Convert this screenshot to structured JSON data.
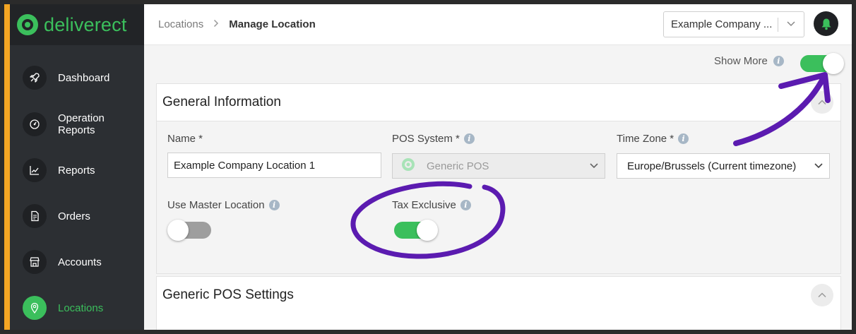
{
  "brand": {
    "name": "deliverect",
    "color": "#3bbf5c",
    "accent": "#f5a623"
  },
  "sidebar": {
    "items": [
      {
        "label": "Dashboard",
        "icon": "rocket-icon",
        "active": false
      },
      {
        "label": "Operation Reports",
        "icon": "gauge-icon",
        "active": false
      },
      {
        "label": "Reports",
        "icon": "chart-icon",
        "active": false
      },
      {
        "label": "Orders",
        "icon": "document-icon",
        "active": false
      },
      {
        "label": "Accounts",
        "icon": "store-icon",
        "active": false
      },
      {
        "label": "Locations",
        "icon": "location-pin-icon",
        "active": true
      }
    ]
  },
  "header": {
    "breadcrumb": {
      "parent": "Locations",
      "current": "Manage Location"
    },
    "company_select": {
      "value": "Example Company ..."
    }
  },
  "show_more": {
    "label": "Show More",
    "enabled": true
  },
  "general_info": {
    "title": "General Information",
    "name": {
      "label": "Name *",
      "value": "Example Company Location 1"
    },
    "pos_system": {
      "label": "POS System *",
      "value": "Generic POS",
      "disabled": true
    },
    "time_zone": {
      "label": "Time Zone *",
      "value": "Europe/Brussels (Current timezone)"
    },
    "use_master_location": {
      "label": "Use Master Location",
      "enabled": false
    },
    "tax_exclusive": {
      "label": "Tax Exclusive",
      "enabled": true
    }
  },
  "generic_pos_settings": {
    "title": "Generic POS Settings"
  },
  "annotation_color": "#5b1bb0"
}
